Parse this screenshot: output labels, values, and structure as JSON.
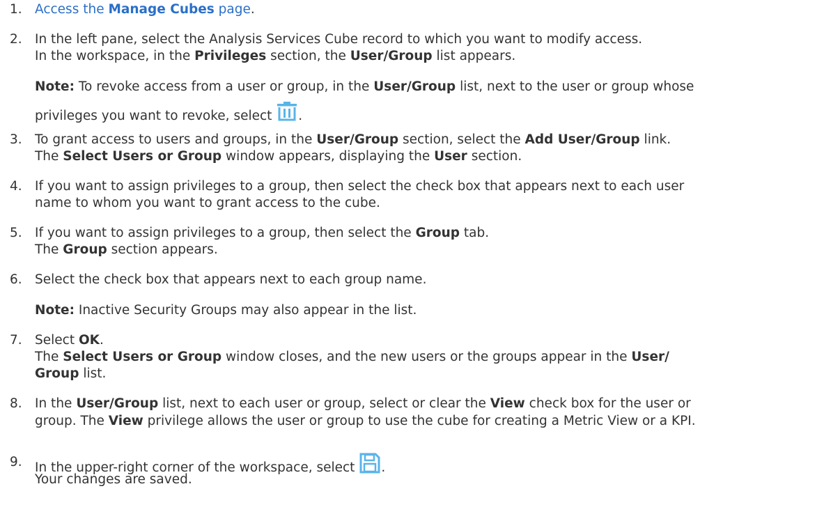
{
  "steps": [
    {
      "num": "1.",
      "link": {
        "pre": "Access the ",
        "bold": "Manage Cubes",
        "post": " page"
      },
      "end": "."
    },
    {
      "num": "2.",
      "line1": "In the left pane, select the Analysis Services Cube record to which you want to modify access.",
      "line2": {
        "a": "In the workspace, in the ",
        "b1": "Privileges",
        "c": " section, the ",
        "b2": "User/Group",
        "d": " list appears."
      },
      "note": {
        "label": "Note:",
        "a": " To revoke access from a user or group, in the ",
        "b": "User/Group",
        "c": " list, next to the user or group whose",
        "line2": "privileges you want to revoke, select ",
        "end": ".",
        "icon": "trash-icon"
      }
    },
    {
      "num": "3.",
      "line1": {
        "a": "To grant access to users and groups, in the ",
        "b1": "User/Group",
        "c": " section, select the ",
        "b2": "Add User/Group",
        "d": " link."
      },
      "line2": {
        "a": "The ",
        "b1": "Select Users or Group",
        "c": " window appears, displaying the ",
        "b2": "User",
        "d": " section."
      }
    },
    {
      "num": "4.",
      "line1": "If you want to assign privileges to a group, then select the check box that appears next to each user",
      "line2": "name to whom you want to grant access to the cube."
    },
    {
      "num": "5.",
      "line1": {
        "a": "If you want to assign privileges to a group, then select the ",
        "b": "Group",
        "c": " tab."
      },
      "line2": {
        "a": "The ",
        "b": "Group",
        "c": " section appears."
      }
    },
    {
      "num": "6.",
      "line1": "Select the check box that appears next to each group name.",
      "note": {
        "label": "Note:",
        "text": " Inactive Security Groups may also appear in the list."
      }
    },
    {
      "num": "7.",
      "line1": {
        "a": "Select ",
        "b": "OK",
        "c": "."
      },
      "line2": {
        "a": "The ",
        "b1": "Select Users or Group",
        "c": " window closes, and the new users or the groups appear in the ",
        "b2": "User/"
      },
      "line3": {
        "b": "Group",
        "c": " list."
      }
    },
    {
      "num": "8.",
      "line1": {
        "a": "In the ",
        "b1": "User/Group",
        "c": " list, next to each user or group, select or clear the ",
        "b2": "View",
        "d": " check box for the user or"
      },
      "line2": {
        "a": "group. The ",
        "b": "View",
        "c": " privilege allows the user or group to use the cube for creating a Metric View or a KPI."
      }
    },
    {
      "num": "9.",
      "line1": {
        "a": "In the upper-right corner of the workspace, select ",
        "end": "."
      },
      "line2": "Your changes are saved.",
      "icon": "save-icon"
    }
  ],
  "colors": {
    "link": "#2a6fc9",
    "icon": "#5ab4e8",
    "text": "#333333"
  }
}
